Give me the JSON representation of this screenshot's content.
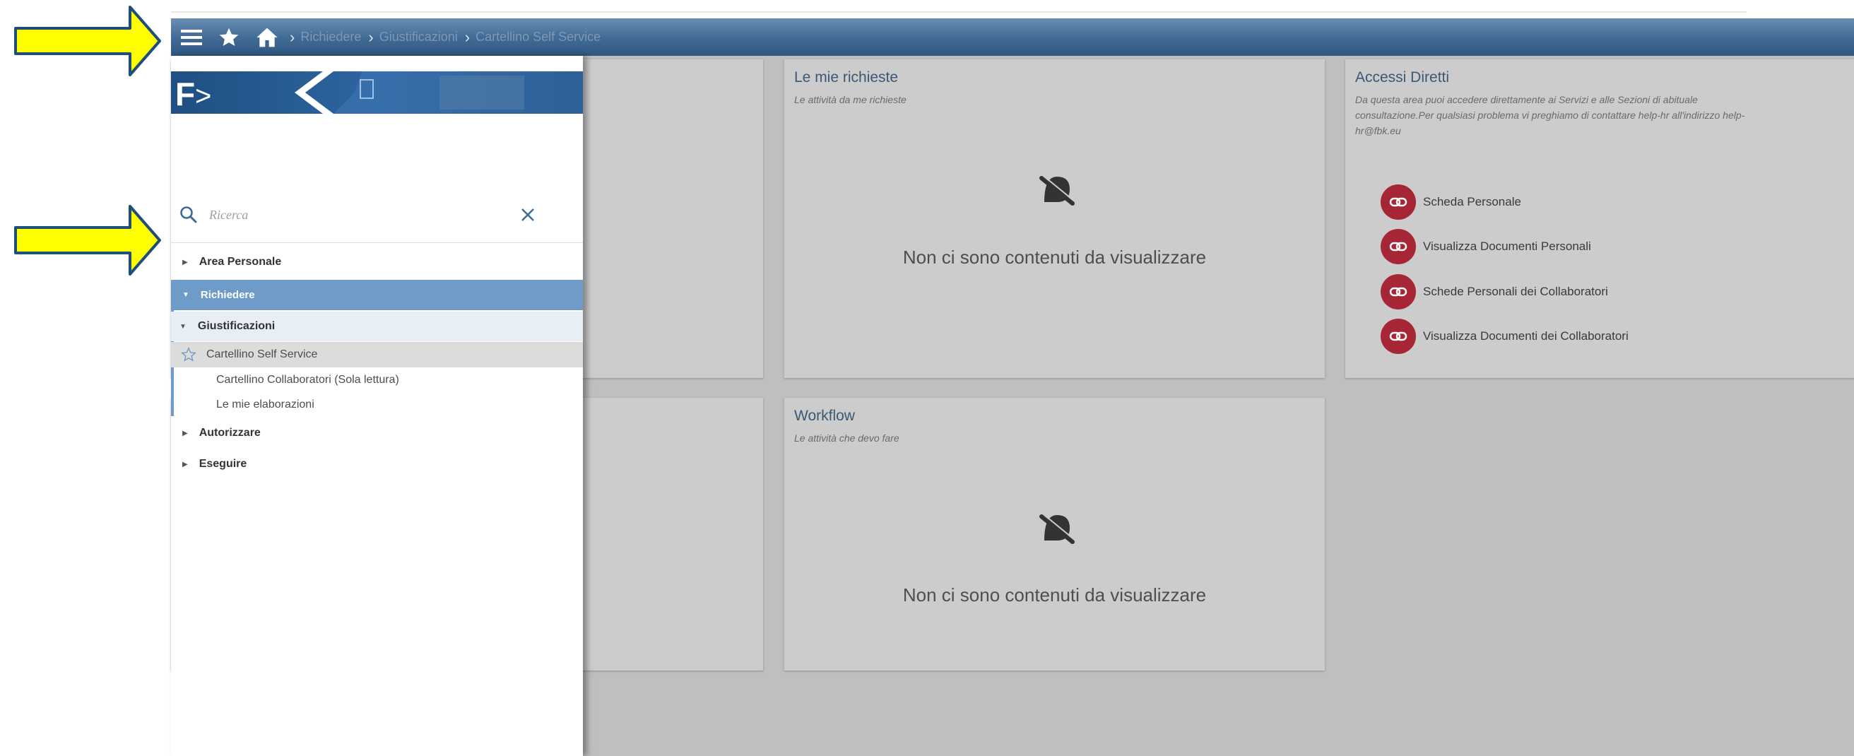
{
  "topbar": {
    "breadcrumbs": [
      "Richiedere",
      "Giustificazioni",
      "Cartellino Self Service"
    ]
  },
  "sidebar": {
    "search_placeholder": "Ricerca",
    "menu": [
      {
        "label": "Area Personale"
      },
      {
        "label": "Richiedere"
      },
      {
        "label": "Giustificazioni"
      },
      {
        "label": "Cartellino Self Service"
      },
      {
        "label": "Cartellino Collaboratori (Sola lettura)"
      },
      {
        "label": "Le mie elaborazioni"
      },
      {
        "label": "Autorizzare"
      },
      {
        "label": "Eseguire"
      }
    ]
  },
  "cards": {
    "richieste": {
      "title": "Le mie richieste",
      "subtitle": "Le attività da me richieste",
      "empty": "Non ci sono contenuti da visualizzare"
    },
    "workflow": {
      "title": "Workflow",
      "subtitle": "Le attività che devo fare",
      "empty": "Non ci sono contenuti da visualizzare"
    },
    "accessi": {
      "title": "Accessi Diretti",
      "subtitle_line1": "Da questa area puoi accedere direttamente ai Servizi e alle Sezioni di abituale",
      "subtitle_line2": "consultazione.Per qualsiasi problema vi preghiamo di contattare help-hr all'indirizzo help-",
      "subtitle_line3": "hr@fbk.eu",
      "links": [
        {
          "label": "Scheda Personale"
        },
        {
          "label": "Visualizza Documenti Personali"
        },
        {
          "label": "Schede Personali dei Collaboratori"
        },
        {
          "label": "Visualizza Documenti dei Collaboratori"
        }
      ]
    }
  },
  "colors": {
    "topbar": "#426c96",
    "selected_menu": "#6f9bc9",
    "link_circle": "#a72636",
    "arrow_fill": "#ffff00",
    "arrow_stroke": "#1f4e79"
  }
}
